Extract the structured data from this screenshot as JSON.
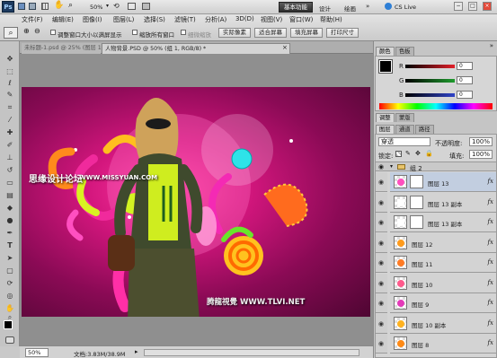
{
  "menubar": {
    "logo": "Ps",
    "items": [
      "文件(F)",
      "编辑(E)",
      "图像(I)",
      "图层(L)",
      "选择(S)",
      "滤镜(T)",
      "分析(A)",
      "3D(D)",
      "视图(V)",
      "窗口(W)",
      "帮助(H)"
    ],
    "zoom": "50%",
    "workspace_active": "基本功能",
    "workspace_links": [
      "设计",
      "绘画"
    ],
    "cs_live": "CS Live",
    "window_buttons": [
      "−",
      "□",
      "×"
    ]
  },
  "options": {
    "checkbox1": "调整窗口大小以满屏显示",
    "checkbox2": "缩放所有窗口",
    "checkbox3": "细微缩放",
    "buttons": [
      "实际像素",
      "适合屏幕",
      "填充屏幕",
      "打印尺寸"
    ]
  },
  "tabs": {
    "tab1": "未标题-1.psd @ 25% (图层 11, RGB/8)",
    "tab2": "人物背景.PSD @ 50% (组 1, RGB/8) *",
    "close": "×"
  },
  "watermarks": {
    "left": "思缘设计论坛",
    "left_url": "WWW.MISSYUAN.COM",
    "bottom": "腾龍視覺 WWW.TLVI.NET"
  },
  "status": {
    "zoom": "50%",
    "doc": "文档:3.83M/38.9M"
  },
  "color_panel": {
    "tabs": [
      "颜色",
      "色板"
    ],
    "rows": [
      {
        "label": "R",
        "value": "0",
        "color": "#e2202a"
      },
      {
        "label": "G",
        "value": "0",
        "color": "#1e9b2d"
      },
      {
        "label": "B",
        "value": "0",
        "color": "#2f43c8"
      }
    ]
  },
  "adjust_panel": {
    "tabs": [
      "调整",
      "蒙版"
    ]
  },
  "layers_panel": {
    "tabs": [
      "图层",
      "通道",
      "路径"
    ],
    "blend_mode": "穿透",
    "opacity_label": "不透明度:",
    "opacity": "100%",
    "lock_label": "锁定:",
    "fill_label": "填充:",
    "fill": "100%",
    "group_label": "组 2",
    "layers": [
      {
        "name": "图层 13",
        "fx": "fx",
        "swatch": "#ff4fbf"
      },
      {
        "name": "图层 13 副本",
        "fx": "fx",
        "swatch": "#ffffff"
      },
      {
        "name": "图层 13 副本",
        "fx": "fx",
        "swatch": "#ffffff"
      },
      {
        "name": "图层 12",
        "fx": "fx",
        "swatch": "#ff9b1c"
      },
      {
        "name": "图层 11",
        "fx": "fx",
        "swatch": "#ff7b24"
      },
      {
        "name": "图层 10",
        "fx": "fx",
        "swatch": "#ff5a8c"
      },
      {
        "name": "图层 9",
        "fx": "fx",
        "swatch": "#e43ab9"
      },
      {
        "name": "图层 10 副本",
        "fx": "fx",
        "swatch": "#ffb21f"
      },
      {
        "name": "图层 8",
        "fx": "fx",
        "swatch": "#ff8a15"
      }
    ]
  }
}
